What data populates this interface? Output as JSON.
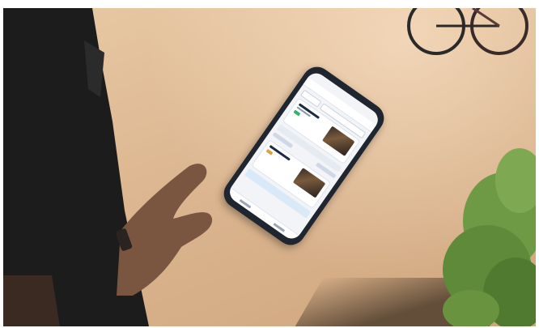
{
  "scene": {
    "description_hidden": "",
    "colors": {
      "pavement": "#dcb791",
      "phone_case": "#1f2630",
      "screen_bg": "#f2f4f7",
      "accent_blue": "#1d3557",
      "badge_green": "#2fb36b",
      "badge_orange": "#e0a13a",
      "grass": "#5f8a3a",
      "shirt": "#1c1c1c",
      "skin": "#7a5540"
    },
    "icons": {
      "phone": "smartphone-icon",
      "bicycle": "bicycle-icon",
      "plant": "plant-icon"
    }
  }
}
